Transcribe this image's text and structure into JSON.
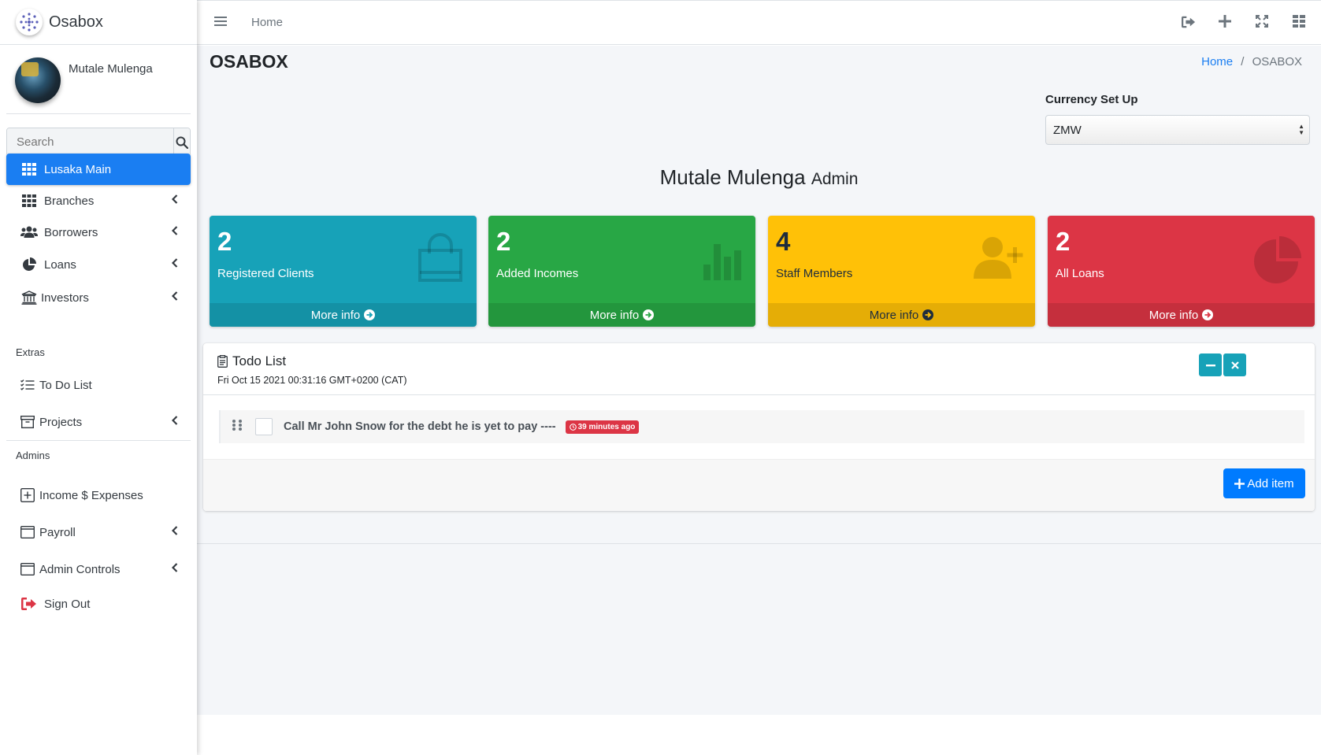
{
  "brand": {
    "name": "Osabox"
  },
  "user": {
    "name": "Mutale Mulenga"
  },
  "search": {
    "placeholder": "Search"
  },
  "sidebar": {
    "items": [
      {
        "label": "Lusaka Main",
        "icon": "grid-icon",
        "active": true
      },
      {
        "label": "Branches",
        "icon": "grid-icon"
      },
      {
        "label": "Borrowers",
        "icon": "users-icon"
      },
      {
        "label": "Loans",
        "icon": "pie-chart-icon"
      },
      {
        "label": "Investors",
        "icon": "bank-icon"
      }
    ],
    "extras_header": "Extras",
    "extras": [
      {
        "label": "To Do List",
        "icon": "list-icon"
      },
      {
        "label": "Projects",
        "icon": "archive-icon"
      }
    ],
    "admins_header": "Admins",
    "admins": [
      {
        "label": "Income $ Expenses",
        "icon": "plus-square-icon"
      },
      {
        "label": "Payroll",
        "icon": "window-icon"
      },
      {
        "label": "Admin Controls",
        "icon": "window-icon"
      },
      {
        "label": "Sign Out",
        "icon": "sign-out-icon"
      }
    ]
  },
  "topbar": {
    "home_label": "Home"
  },
  "page": {
    "title": "OSABOX",
    "breadcrumb": {
      "home": "Home",
      "separator": "/",
      "current": "OSABOX"
    },
    "currency_label": "Currency Set Up",
    "currency_value": "ZMW",
    "admin_name": "Mutale Mulenga",
    "admin_role": "Admin"
  },
  "stats": [
    {
      "value": "2",
      "label": "Registered Clients",
      "footer": "More info",
      "color": "#17a2b8",
      "icon": "shopping-bag-icon"
    },
    {
      "value": "2",
      "label": "Added Incomes",
      "footer": "More info",
      "color": "#28a745",
      "icon": "bar-chart-icon"
    },
    {
      "value": "4",
      "label": "Staff Members",
      "footer": "More info",
      "color": "#ffc107",
      "icon": "user-plus-icon"
    },
    {
      "value": "2",
      "label": "All Loans",
      "footer": "More info",
      "color": "#dc3545",
      "icon": "pie-chart-icon"
    }
  ],
  "todo": {
    "title": "Todo List",
    "date": "Fri Oct 15 2021 00:31:16 GMT+0200 (CAT)",
    "items": [
      {
        "text": "Call Mr John Snow for the debt he is yet to pay ----",
        "badge": "39 minutes ago",
        "checked": false
      }
    ],
    "add_label": "Add item"
  },
  "colors": {
    "primary": "#1a7ef2",
    "info": "#17a2b8",
    "success": "#28a745",
    "warning": "#ffc107",
    "danger": "#dc3545"
  }
}
